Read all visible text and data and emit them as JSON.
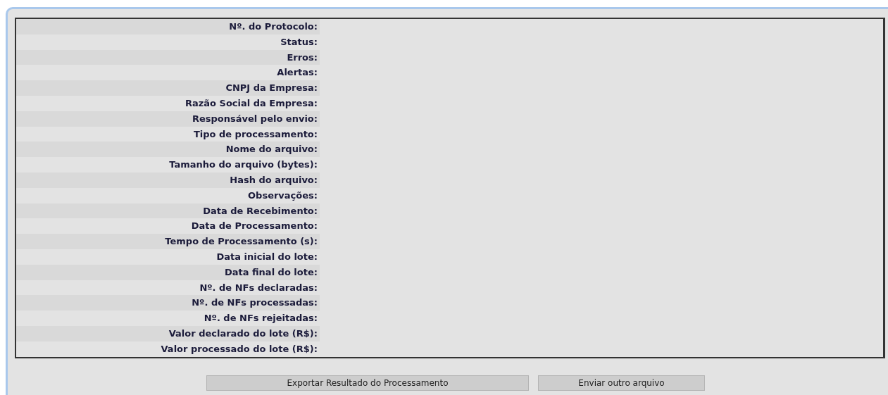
{
  "fields": [
    {
      "label": "Nº. do Protocolo:"
    },
    {
      "label": "Status:"
    },
    {
      "label": "Erros:"
    },
    {
      "label": "Alertas:"
    },
    {
      "label": "CNPJ da Empresa:"
    },
    {
      "label": "Razão Social da Empresa:"
    },
    {
      "label": "Responsável pelo envio:"
    },
    {
      "label": "Tipo de processamento:"
    },
    {
      "label": "Nome do arquivo:"
    },
    {
      "label": "Tamanho do arquivo (bytes):"
    },
    {
      "label": "Hash do arquivo:"
    },
    {
      "label": "Observações:"
    },
    {
      "label": "Data de Recebimento:"
    },
    {
      "label": "Data de Processamento:"
    },
    {
      "label": "Tempo de Processamento (s):"
    },
    {
      "label": "Data inicial do lote:"
    },
    {
      "label": "Data final do lote:"
    },
    {
      "label": "Nº. de NFs declaradas:"
    },
    {
      "label": "Nº. de NFs processadas:"
    },
    {
      "label": "Nº. de NFs rejeitadas:"
    },
    {
      "label": "Valor declarado do lote (R$):"
    },
    {
      "label": "Valor processado do lote (R$):"
    }
  ],
  "buttons": [
    {
      "label": "Exportar Resultado do Processamento"
    },
    {
      "label": "Enviar outro arquivo"
    }
  ]
}
